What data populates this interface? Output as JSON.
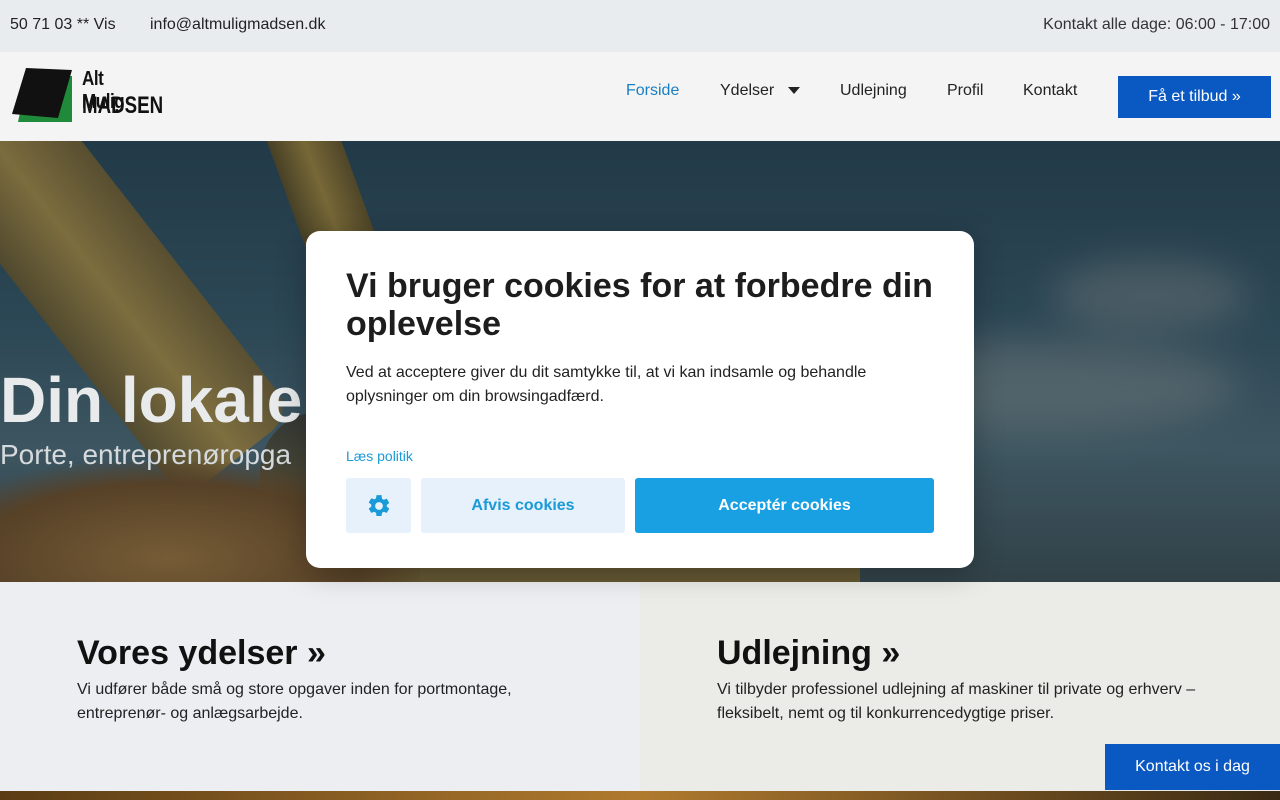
{
  "topbar": {
    "phone": "50 71 03 ** Vis",
    "email": "info@altmuligmadsen.dk",
    "hours": "Kontakt alle dage: 06:00 - 17:00"
  },
  "header": {
    "logo_line1": "Alt Mulig",
    "logo_line2": "MADSEN",
    "nav": [
      {
        "label": "Forside",
        "active": true
      },
      {
        "label": "Ydelser",
        "has_dropdown": true
      },
      {
        "label": "Udlejning"
      },
      {
        "label": "Profil"
      },
      {
        "label": "Kontakt"
      }
    ],
    "cta": "Få et tilbud »"
  },
  "hero": {
    "title": "Din lokale",
    "subtitle": "Porte, entreprenøropga"
  },
  "cards": [
    {
      "title": "Vores ydelser »",
      "text": "Vi udfører både små og store opgaver inden for portmontage, entreprenør- og anlægsarbejde."
    },
    {
      "title": "Udlejning »",
      "text": "Vi tilbyder professionel udlejning af maskiner til private og erhverv – fleksibelt, nemt og til konkurrencedygtige priser."
    }
  ],
  "floating_contact": "Kontakt os i dag",
  "cookie_modal": {
    "title": "Vi bruger cookies for at forbedre din oplevelse",
    "description": "Ved at acceptere giver du dit samtykke til, at vi kan indsamle og behandle oplysninger om din browsingadfærd.",
    "policy_link": "Læs politik",
    "settings_icon": "gear-icon",
    "reject_label": "Afvis cookies",
    "accept_label": "Acceptér cookies"
  },
  "colors": {
    "brand_blue": "#0a58c2",
    "cookie_accent": "#18a0e2",
    "active_nav": "#1a7fc1",
    "logo_green": "#1f8a3a"
  }
}
